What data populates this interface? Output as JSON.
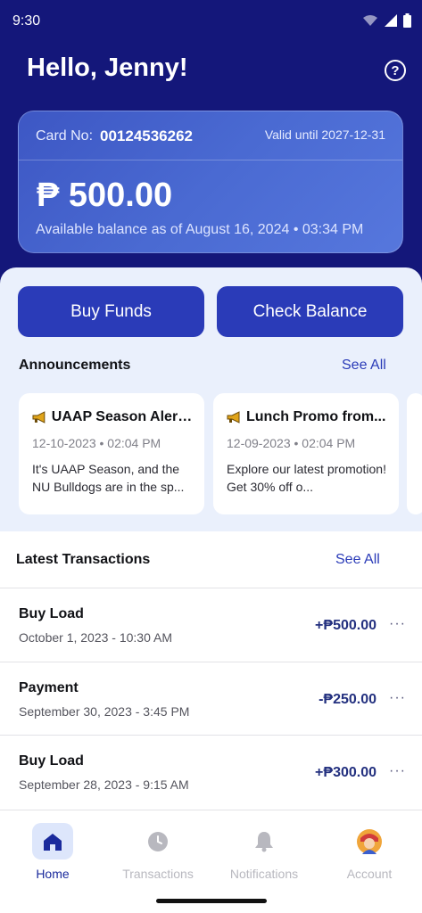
{
  "status_bar": {
    "time": "9:30"
  },
  "header": {
    "greeting": "Hello, Jenny!",
    "help_icon": "question-circle-icon"
  },
  "card": {
    "card_no_label": "Card No:",
    "card_no": "00124536262",
    "valid_until": "Valid until 2027-12-31",
    "balance": "₱ 500.00",
    "as_of": "Available balance as of August 16, 2024 • 03:34 PM"
  },
  "actions": {
    "buy_funds": "Buy Funds",
    "check_balance": "Check Balance"
  },
  "announcements": {
    "title": "Announcements",
    "see_all": "See All",
    "items": [
      {
        "icon": "megaphone-icon",
        "title": "UAAP Season Alert...",
        "date": "12-10-2023 • 02:04 PM",
        "body": "It's UAAP Season, and the NU Bulldogs are in the sp..."
      },
      {
        "icon": "megaphone-icon",
        "title": "Lunch Promo from...",
        "date": "12-09-2023 • 02:04 PM",
        "body": "Explore our latest promotion! Get 30% off o..."
      }
    ]
  },
  "transactions": {
    "title": "Latest Transactions",
    "see_all": "See All",
    "items": [
      {
        "type": "Buy Load",
        "date": "October 1, 2023 - 10:30 AM",
        "amount": "+₱500.00"
      },
      {
        "type": "Payment",
        "date": "September 30, 2023 - 3:45 PM",
        "amount": "-₱250.00"
      },
      {
        "type": "Buy Load",
        "date": "September 28, 2023 - 9:15 AM",
        "amount": "+₱300.00"
      }
    ],
    "more_glyph": "···"
  },
  "nav": {
    "items": [
      {
        "label": "Home",
        "icon": "home-icon",
        "active": true
      },
      {
        "label": "Transactions",
        "icon": "clock-icon",
        "active": false
      },
      {
        "label": "Notifications",
        "icon": "bell-icon",
        "active": false
      },
      {
        "label": "Account",
        "icon": "avatar-icon",
        "active": false
      }
    ]
  },
  "colors": {
    "hero_bg": "#14177a",
    "accent": "#2a3bb8",
    "panel_bg": "#eaf0fc",
    "amount": "#23307f"
  }
}
